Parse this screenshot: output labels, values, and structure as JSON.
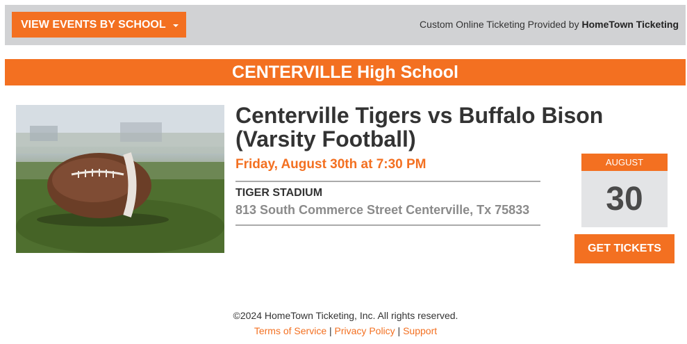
{
  "header": {
    "school_button_label": "VIEW EVENTS BY SCHOOL",
    "provider_prefix": "Custom Online Ticketing Provided by",
    "provider_brand": "HomeTown Ticketing"
  },
  "school": {
    "name": "CENTERVILLE High School"
  },
  "event": {
    "title": "Centerville Tigers vs Buffalo Bison (Varsity Football)",
    "datetime": "Friday, August 30th at 7:30 PM",
    "venue": "TIGER STADIUM",
    "address": "813 South Commerce Street Centerville, Tx 75833",
    "month": "AUGUST",
    "day": "30",
    "cta_label": "GET TICKETS",
    "image_icon": "football-photo"
  },
  "footer": {
    "copyright": "©2024 HomeTown Ticketing, Inc. All rights reserved.",
    "links": [
      "Terms of Service",
      "Privacy Policy",
      "Support"
    ],
    "separator": " | "
  },
  "colors": {
    "accent": "#f37021",
    "topbar": "#d1d2d4",
    "calendar_bg": "#e3e4e6"
  }
}
